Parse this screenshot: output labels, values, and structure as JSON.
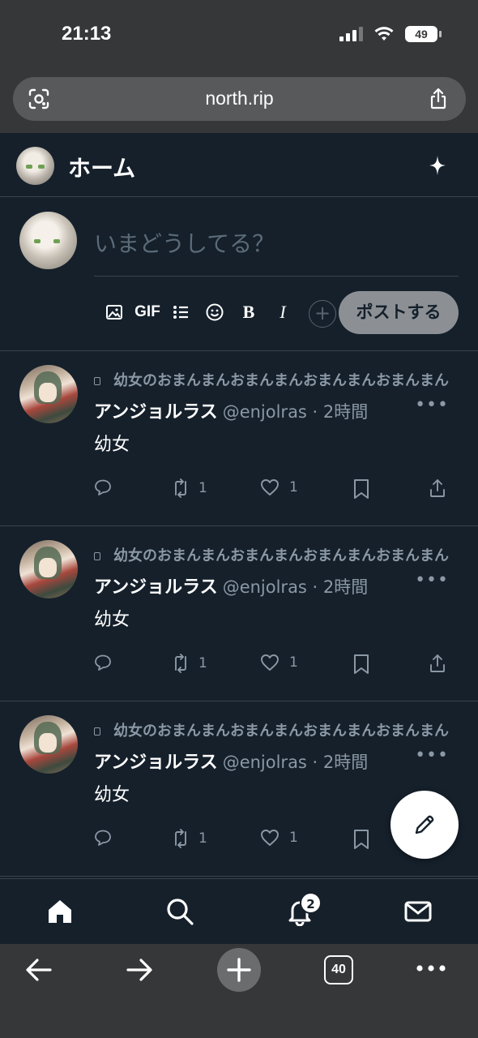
{
  "status_bar": {
    "time": "21:13",
    "battery": "49"
  },
  "browser": {
    "url": "north.rip",
    "tab_count": "40"
  },
  "header": {
    "title": "ホーム"
  },
  "compose": {
    "placeholder": "いまどうしてる？",
    "toolbar": {
      "gif": "GIF",
      "bold": "B",
      "italic": "I",
      "add": "+"
    },
    "post_button": "ポストする"
  },
  "posts": [
    {
      "context": "幼女のおまんまんおまんまんおまんまんおまんまん",
      "name": "アンジョルラス",
      "handle": "@enjolras · 2時間",
      "body": "幼女",
      "reposts": "1",
      "likes": "1"
    },
    {
      "context": "幼女のおまんまんおまんまんおまんまんおまんまん",
      "name": "アンジョルラス",
      "handle": "@enjolras · 2時間",
      "body": "幼女",
      "reposts": "1",
      "likes": "1"
    },
    {
      "context": "幼女のおまんまんおまんまんおまんまんおまんまん",
      "name": "アンジョルラス",
      "handle": "@enjolras · 2時間",
      "body": "幼女",
      "reposts": "1",
      "likes": "1"
    }
  ],
  "nav": {
    "notification_badge": "2"
  },
  "colors": {
    "background": "#15202b",
    "browser_chrome": "#363738",
    "muted_text": "#8b98a5",
    "border": "#38444d"
  },
  "icons": [
    "lens-icon",
    "share-icon",
    "sparkle-icon",
    "image-icon",
    "list-icon",
    "emoji-icon",
    "reply-icon",
    "repost-icon",
    "like-icon",
    "bookmark-icon",
    "pencil-icon",
    "home-icon",
    "search-icon",
    "bell-icon",
    "mail-icon",
    "back-icon",
    "forward-icon",
    "plus-icon",
    "more-icon"
  ]
}
